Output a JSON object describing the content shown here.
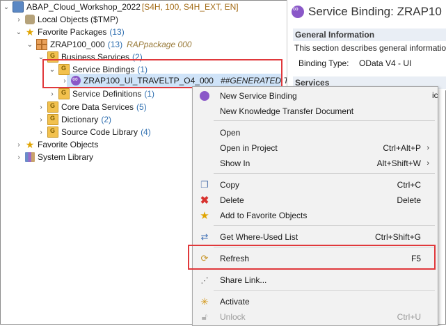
{
  "tree": {
    "root": {
      "label": "ABAP_Cloud_Workshop_2022",
      "meta": "[S4H, 100, S4H_EXT, EN]"
    },
    "local_objects": {
      "label": "Local Objects ($TMP)"
    },
    "favorite_packages": {
      "label": "Favorite Packages",
      "count": "(13)"
    },
    "package": {
      "label": "ZRAP100_000",
      "count": "(13)",
      "desc": "RAPpackage 000"
    },
    "business_services": {
      "label": "Business Services",
      "count": "(2)"
    },
    "service_bindings": {
      "label": "Service Bindings",
      "count": "(1)"
    },
    "binding_item": {
      "label": "ZRAP100_UI_TRAVELTP_O4_000",
      "desc": "##GENERATED Trave"
    },
    "service_definitions": {
      "label": "Service Definitions",
      "count": "(1)"
    },
    "core_data_services": {
      "label": "Core Data Services",
      "count": "(5)"
    },
    "dictionary": {
      "label": "Dictionary",
      "count": "(2)"
    },
    "source_code_library": {
      "label": "Source Code Library",
      "count": "(4)"
    },
    "favorite_objects": {
      "label": "Favorite Objects"
    },
    "system_library": {
      "label": "System Library"
    }
  },
  "editor": {
    "title": "Service Binding: ZRAP10",
    "general_info_header": "General Information",
    "general_info_desc": "This section describes general information",
    "binding_type_label": "Binding Type:",
    "binding_type_value": "OData V4 - UI",
    "services_header": "Services",
    "services_trailing": "ic"
  },
  "menu": {
    "items": [
      {
        "label": "New Service Binding",
        "shortcut": "",
        "icon": "service-binding-icon"
      },
      {
        "label": "New Knowledge Transfer Document",
        "shortcut": "",
        "icon": ""
      },
      {
        "label": "Open",
        "shortcut": "",
        "icon": ""
      },
      {
        "label": "Open in Project",
        "shortcut": "Ctrl+Alt+P",
        "icon": ""
      },
      {
        "label": "Show In",
        "shortcut": "Alt+Shift+W",
        "icon": ""
      },
      {
        "label": "Copy",
        "shortcut": "Ctrl+C",
        "icon": "copy-icon"
      },
      {
        "label": "Delete",
        "shortcut": "Delete",
        "icon": "delete-icon"
      },
      {
        "label": "Add to Favorite Objects",
        "shortcut": "",
        "icon": "star-icon"
      },
      {
        "label": "Get Where-Used List",
        "shortcut": "Ctrl+Shift+G",
        "icon": "where-used-icon"
      },
      {
        "label": "Refresh",
        "shortcut": "F5",
        "icon": "refresh-icon"
      },
      {
        "label": "Share Link...",
        "shortcut": "",
        "icon": "share-link-icon"
      },
      {
        "label": "Activate",
        "shortcut": "",
        "icon": "activate-icon"
      },
      {
        "label": "Unlock",
        "shortcut": "Ctrl+U",
        "icon": "unlock-icon"
      }
    ],
    "submenu_arrow": "›"
  },
  "colors": {
    "highlight_border": "#e0383b",
    "selection": "#cfe3f8",
    "count_blue": "#2f6fb0",
    "menu_bg": "#f2f2f2"
  }
}
